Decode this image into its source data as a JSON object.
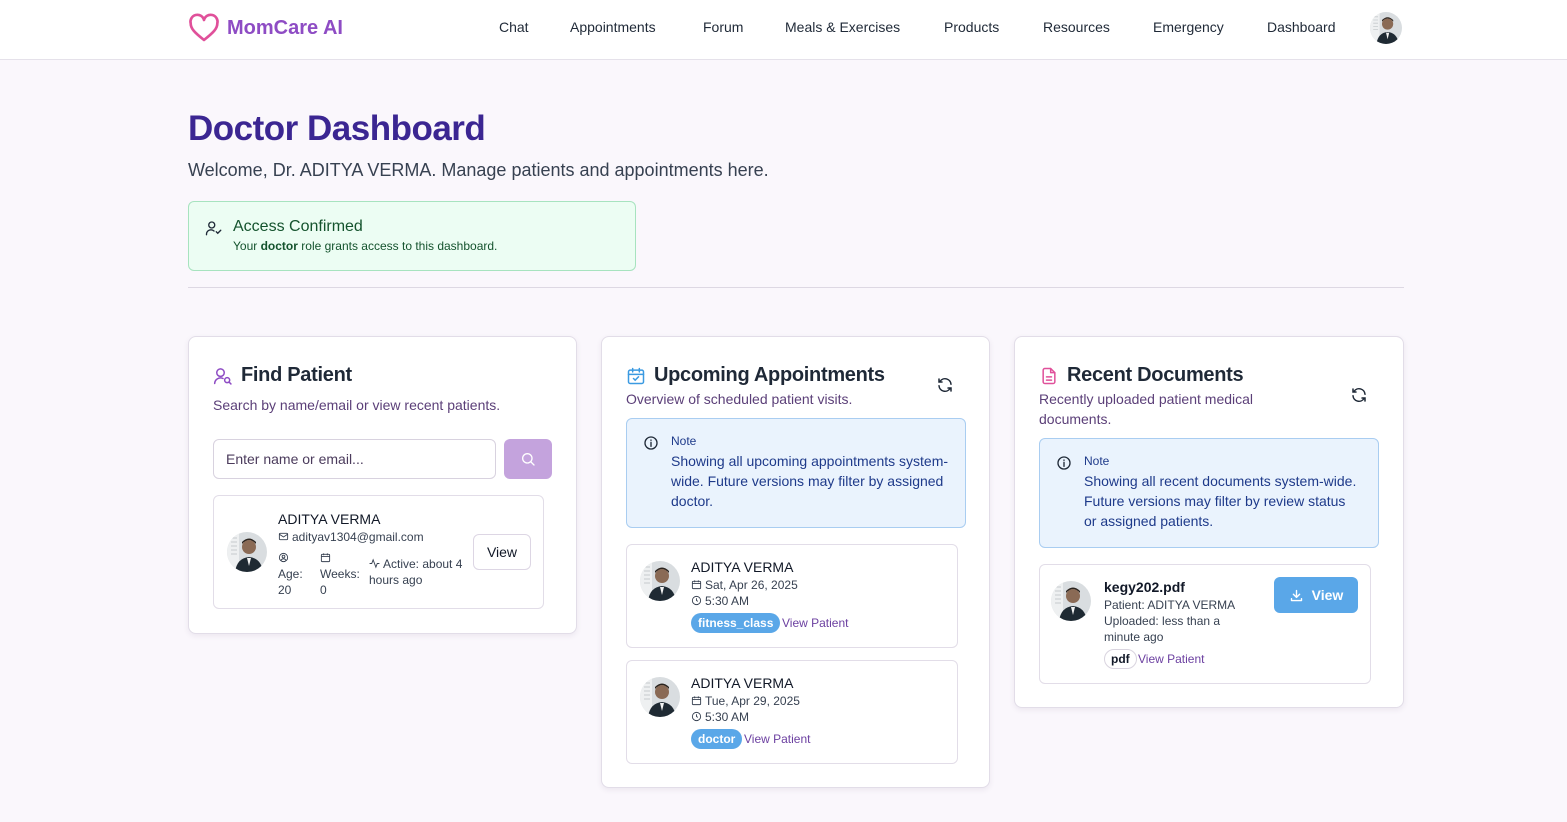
{
  "brand": {
    "name": "MomCare AI",
    "accent": "#8e4cc4",
    "logo_icon": "heart-icon"
  },
  "nav": {
    "items": [
      {
        "label": "Chat"
      },
      {
        "label": "Appointments"
      },
      {
        "label": "Forum"
      },
      {
        "label": "Meals & Exercises"
      },
      {
        "label": "Products"
      },
      {
        "label": "Resources"
      },
      {
        "label": "Emergency"
      },
      {
        "label": "Dashboard"
      }
    ]
  },
  "page": {
    "title": "Doctor Dashboard",
    "welcome": "Welcome, Dr. ADITYA VERMA. Manage patients and appointments here.",
    "title_color": "#3b2692"
  },
  "access": {
    "title": "Access Confirmed",
    "text_before": "Your ",
    "role": "doctor",
    "text_after": " role grants access to this dashboard."
  },
  "find_patient": {
    "title": "Find Patient",
    "subtitle": "Search by name/email or view recent patients.",
    "placeholder": "Enter name or email...",
    "patient": {
      "name": "ADITYA VERMA",
      "email": "adityav1304@gmail.com",
      "age_label": "Age:",
      "age": "20",
      "weeks_label": "Weeks:",
      "weeks": "0",
      "active": "Active: about 4 hours ago",
      "view_label": "View"
    }
  },
  "appointments": {
    "title": "Upcoming Appointments",
    "subtitle": "Overview of scheduled patient visits.",
    "note_title": "Note",
    "note_text": "Showing all upcoming appointments system-wide. Future versions may filter by assigned doctor.",
    "items": [
      {
        "name": "ADITYA VERMA",
        "date": "Sat, Apr 26, 2025",
        "time": "5:30 AM",
        "type": "fitness_class",
        "link": "View Patient"
      },
      {
        "name": "ADITYA VERMA",
        "date": "Tue, Apr 29, 2025",
        "time": "5:30 AM",
        "type": "doctor",
        "link": "View Patient"
      }
    ]
  },
  "documents": {
    "title": "Recent Documents",
    "subtitle": "Recently uploaded patient medical documents.",
    "note_title": "Note",
    "note_text": "Showing all recent documents system-wide. Future versions may filter by review status or assigned patients.",
    "items": [
      {
        "file": "kegy202.pdf",
        "patient": "Patient: ADITYA VERMA",
        "uploaded": "Uploaded: less than a minute ago",
        "ext": "pdf",
        "link": "View Patient",
        "view_label": "View"
      }
    ]
  },
  "colors": {
    "badge_blue": "#5aa7e8",
    "success_bg": "#ecfdf3",
    "note_bg": "#eaf3fd"
  }
}
